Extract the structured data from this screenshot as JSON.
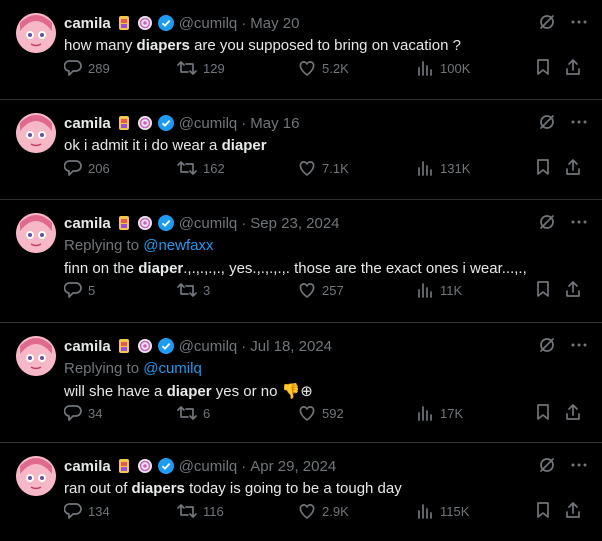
{
  "tweets": [
    {
      "name": "camila",
      "handle": "@cumilq",
      "date": "May 20",
      "replying_label": "",
      "replying_to": "",
      "text_parts": [
        "how many ",
        "diapers",
        " are you supposed to bring on vacation ?"
      ],
      "replies": "289",
      "reposts": "129",
      "likes": "5.2K",
      "views": "100K"
    },
    {
      "name": "camila",
      "handle": "@cumilq",
      "date": "May 16",
      "replying_label": "",
      "replying_to": "",
      "text_parts": [
        "ok i admit it i do wear a ",
        "diaper",
        ""
      ],
      "replies": "206",
      "reposts": "162",
      "likes": "7.1K",
      "views": "131K"
    },
    {
      "name": "camila",
      "handle": "@cumilq",
      "date": "Sep 23, 2024",
      "replying_label": "Replying to",
      "replying_to": "@newfaxx",
      "text_parts": [
        "finn on the ",
        "diaper",
        ".,.,.,.,., yes.,.,.,.,. those are the exact ones i wear...,.,"
      ],
      "replies": "5",
      "reposts": "3",
      "likes": "257",
      "views": "11K"
    },
    {
      "name": "camila",
      "handle": "@cumilq",
      "date": "Jul 18, 2024",
      "replying_label": "Replying to",
      "replying_to": "@cumilq",
      "text_parts": [
        "will she have a ",
        "diaper",
        " yes or no 👎⊕"
      ],
      "replies": "34",
      "reposts": "6",
      "likes": "592",
      "views": "17K"
    },
    {
      "name": "camila",
      "handle": "@cumilq",
      "date": "Apr 29, 2024",
      "replying_label": "",
      "replying_to": "",
      "text_parts": [
        "ran out of ",
        "diapers",
        " today is going to be a tough day"
      ],
      "replies": "134",
      "reposts": "116",
      "likes": "2.9K",
      "views": "115K"
    }
  ],
  "icons": [
    "grok-icon",
    "more-icon",
    "reply-icon",
    "repost-icon",
    "like-icon",
    "views-icon",
    "bookmark-icon",
    "share-icon",
    "verified-badge-icon"
  ],
  "colors": {
    "background": "#000000",
    "text": "#e7e9ea",
    "muted": "#71767b",
    "accent": "#1d9bf0",
    "divider": "#2f3336"
  }
}
